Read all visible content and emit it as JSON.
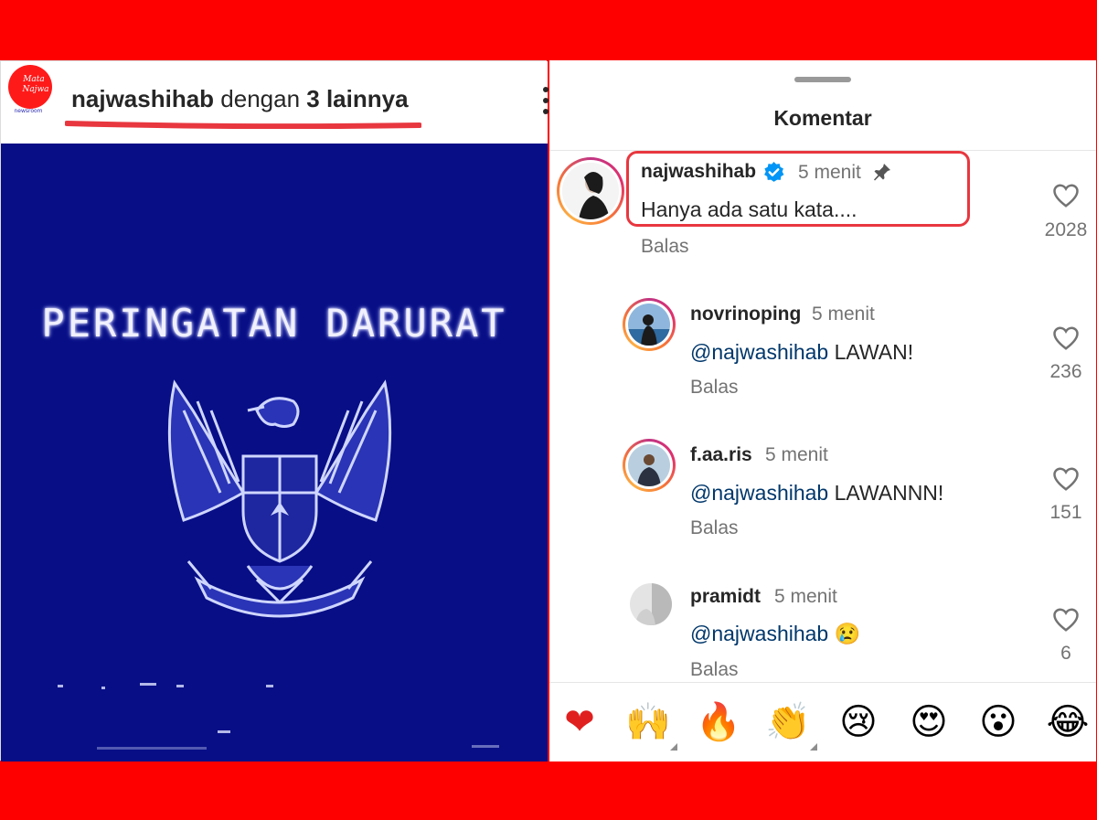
{
  "post": {
    "logo_text_line1": "Mata",
    "logo_text_line2": "Najwa",
    "logo_text_line3": "newsroom",
    "user_bold": "najwashihab",
    "user_mid": " dengan ",
    "user_count": "3 lainnya",
    "image_text": "PERINGATAN DARURAT"
  },
  "sheet": {
    "title": "Komentar"
  },
  "comments": [
    {
      "user": "najwashihab",
      "time": "5 menit",
      "text": "Hanya ada satu kata....",
      "reply": "Balas",
      "likes": "2028",
      "verified": true,
      "pinned": true
    },
    {
      "user": "novrinoping",
      "time": "5 menit",
      "mention": "@najwashihab",
      "text": " LAWAN!",
      "reply": "Balas",
      "likes": "236"
    },
    {
      "user": "f.aa.ris",
      "time": "5 menit",
      "mention": "@najwashihab",
      "text": " LAWANNN!",
      "reply": "Balas",
      "likes": "151"
    },
    {
      "user": "pramidt",
      "time": "5 menit",
      "mention": "@najwashihab",
      "text": " 😢",
      "reply": "Balas",
      "likes": "6"
    }
  ],
  "reactions": [
    "❤",
    "🙌",
    "🔥",
    "👏",
    "😢",
    "😍",
    "😮",
    "😂"
  ],
  "colors": {
    "frame": "#ff0000",
    "image_bg": "#070e86",
    "highlight": "#e8373f",
    "mention": "#00376b",
    "verified": "#0095f6"
  }
}
